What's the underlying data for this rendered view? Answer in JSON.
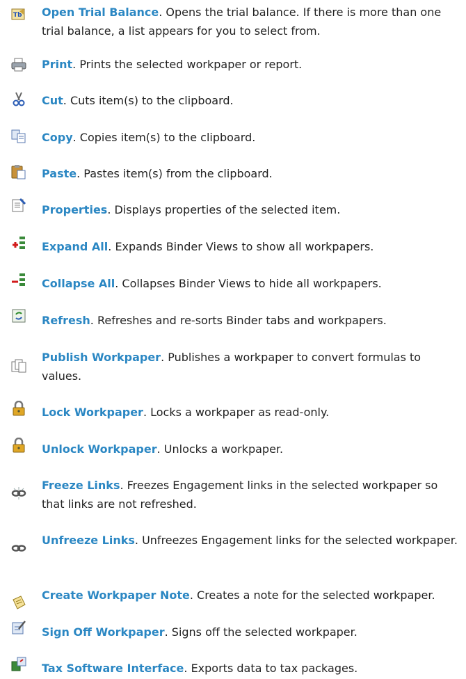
{
  "items": [
    {
      "term": "Open Trial Balance",
      "desc": ". Opens the trial balance. If there is more than one trial balance, a list appears for you to select from.",
      "icon": "trial-balance-icon"
    },
    {
      "term": "Print",
      "desc": ". Prints the selected workpaper or report.",
      "icon": "printer-icon"
    },
    {
      "term": "Cut",
      "desc": ". Cuts item(s) to the clipboard.",
      "icon": "scissors-icon"
    },
    {
      "term": "Copy",
      "desc": ". Copies item(s) to the clipboard.",
      "icon": "copy-icon"
    },
    {
      "term": "Paste",
      "desc": ". Pastes item(s) from the clipboard.",
      "icon": "paste-icon"
    },
    {
      "term": "Properties",
      "desc": ". Displays properties of the selected item.",
      "icon": "properties-icon"
    },
    {
      "term": "Expand All",
      "desc": ". Expands Binder Views to show all workpapers.",
      "icon": "expand-all-icon"
    },
    {
      "term": "Collapse All",
      "desc": ". Collapses Binder Views to hide all workpapers.",
      "icon": "collapse-all-icon"
    },
    {
      "term": "Refresh",
      "desc": ". Refreshes and re-sorts Binder tabs and workpapers.",
      "icon": "refresh-icon"
    },
    {
      "term": "Publish Workpaper",
      "desc": ". Publishes a workpaper to convert formulas to values.",
      "icon": "publish-icon"
    },
    {
      "term": "Lock Workpaper",
      "desc": ". Locks a workpaper as read-only.",
      "icon": "lock-icon"
    },
    {
      "term": "Unlock Workpaper",
      "desc": ". Unlocks a workpaper.",
      "icon": "unlock-icon"
    },
    {
      "term": "Freeze Links",
      "desc": ". Freezes Engagement links in the selected workpaper so that links are not refreshed.",
      "icon": "freeze-links-icon"
    },
    {
      "term": "Unfreeze Links",
      "desc": ". Unfreezes Engagement links for the selected workpaper.",
      "icon": "unfreeze-links-icon"
    },
    {
      "term": "Create Workpaper Note",
      "desc": ". Creates a note for the selected workpaper.",
      "icon": "note-icon"
    },
    {
      "term": "Sign Off Workpaper",
      "desc": ". Signs off the selected workpaper.",
      "icon": "sign-off-icon"
    },
    {
      "term": "Tax Software Interface",
      "desc": ". Exports data to tax packages.",
      "icon": "tax-interface-icon"
    }
  ],
  "colors": {
    "term": "#2b87c3",
    "text": "#222222"
  }
}
